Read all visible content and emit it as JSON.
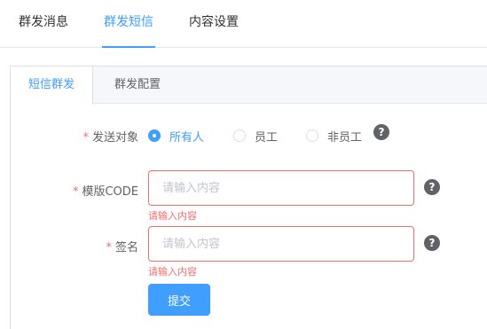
{
  "top_tabs": [
    {
      "label": "群发消息"
    },
    {
      "label": "群发短信"
    },
    {
      "label": "内容设置"
    }
  ],
  "card_tabs": [
    {
      "label": "短信群发"
    },
    {
      "label": "群发配置"
    }
  ],
  "form": {
    "required_mark": "*",
    "target": {
      "label": "发送对象",
      "options": [
        "所有人",
        "员工",
        "非员工"
      ],
      "selected": "所有人"
    },
    "template_code": {
      "label": "模版CODE",
      "placeholder": "请输入内容",
      "error": "请输入内容"
    },
    "signature": {
      "label": "签名",
      "placeholder": "请输入内容",
      "error": "请输入内容"
    },
    "help_symbol": "?",
    "submit_label": "提交"
  },
  "colors": {
    "accent": "#409eff",
    "error": "#f56c6c"
  }
}
